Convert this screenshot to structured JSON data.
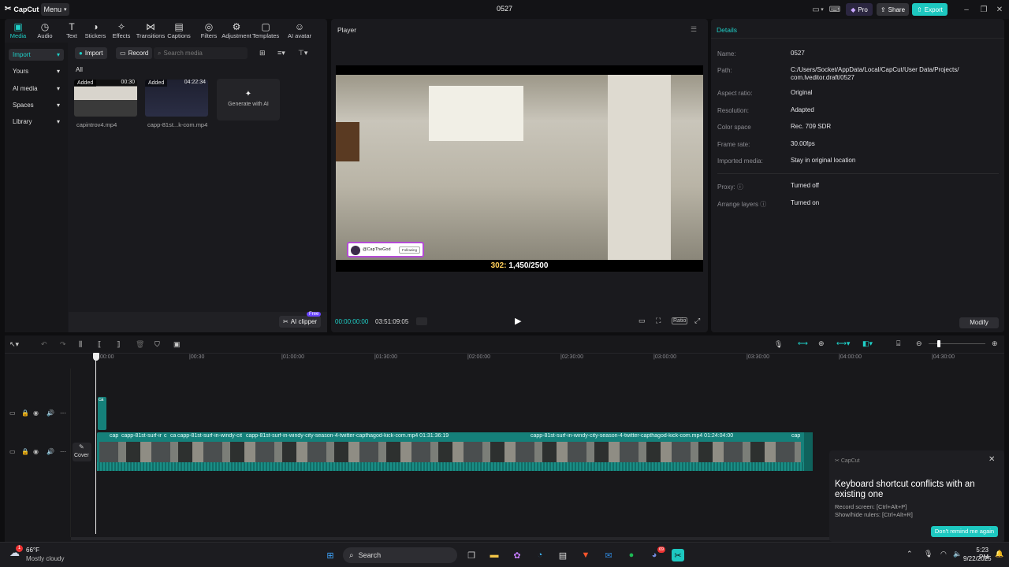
{
  "app": {
    "logo_text": "CapCut",
    "menu_label": "Menu",
    "project_title": "0527"
  },
  "topbar": {
    "pro_label": "Pro",
    "share_label": "Share",
    "export_label": "Export"
  },
  "media_tabs": [
    {
      "label": "Media",
      "icon": "media-icon"
    },
    {
      "label": "Audio",
      "icon": "audio-icon"
    },
    {
      "label": "Text",
      "icon": "text-icon"
    },
    {
      "label": "Stickers",
      "icon": "stickers-icon"
    },
    {
      "label": "Effects",
      "icon": "effects-icon"
    },
    {
      "label": "Transitions",
      "icon": "transitions-icon"
    },
    {
      "label": "Captions",
      "icon": "captions-icon"
    },
    {
      "label": "Filters",
      "icon": "filters-icon"
    },
    {
      "label": "Adjustment",
      "icon": "adjustment-icon"
    },
    {
      "label": "Templates",
      "icon": "templates-icon"
    },
    {
      "label": "AI avatar",
      "icon": "ai-avatar-icon"
    }
  ],
  "sidebar": {
    "items": [
      {
        "label": "Import"
      },
      {
        "label": "Yours"
      },
      {
        "label": "AI media"
      },
      {
        "label": "Spaces"
      },
      {
        "label": "Library"
      }
    ]
  },
  "media": {
    "import_label": "Import",
    "record_label": "Record",
    "search_placeholder": "Search media",
    "filter_label": "All",
    "items": [
      {
        "badge": "Added",
        "duration": "00:30",
        "name": "capintrov4.mp4"
      },
      {
        "badge": "Added",
        "duration": "04:22:34",
        "name": "capp-81st...k-com.mp4"
      }
    ],
    "generate_label": "Generate with AI",
    "ai_clipper_label": "AI clipper",
    "ai_clipper_badge": "Free"
  },
  "player": {
    "title": "Player",
    "current_time": "00:00:00:00",
    "total_time": "03:51:09:05",
    "ratio_label": "Ratio",
    "overlay_counter_a": "302:",
    "overlay_counter_b": "1,450/2500",
    "overlay_handle": "@CapTheGod",
    "overlay_follow": "Following"
  },
  "details": {
    "title": "Details",
    "rows": [
      {
        "label": "Name:",
        "value": "0527"
      },
      {
        "label": "Path:",
        "value": "C:/Users/Socket/AppData/Local/CapCut/User Data/Projects/",
        "value2": "com.lveditor.draft/0527"
      },
      {
        "label": "Aspect ratio:",
        "value": "Original"
      },
      {
        "label": "Resolution:",
        "value": "Adapted"
      },
      {
        "label": "Color space",
        "value": "Rec. 709 SDR"
      },
      {
        "label": "Frame rate:",
        "value": "30.00fps"
      },
      {
        "label": "Imported media:",
        "value": "Stay in original location"
      },
      {
        "label": "Proxy:",
        "value": "Turned off"
      },
      {
        "label": "Arrange layers",
        "value": "Turned on"
      }
    ],
    "modify_label": "Modify"
  },
  "timeline": {
    "ticks": [
      "00:00",
      "|00:30",
      "|01:00:00",
      "|01:30:00",
      "|02:00:00",
      "|02:30:00",
      "|03:00:00",
      "|03:30:00",
      "|04:00:00",
      "|04:30:00"
    ],
    "cover_label": "Cover",
    "small_clip_label": "ca",
    "clips": [
      {
        "label": "cap"
      },
      {
        "label": "capp-81st-surf-ir"
      },
      {
        "label": "c"
      },
      {
        "label": "ca"
      },
      {
        "label": "capp-81st-surf-in-windy-cit"
      },
      {
        "label": "capp-81st-surf-in-windy-city-season-4-twitter-capthagod-kick-com.mp4   01:31:36:19"
      },
      {
        "label": "capp-81st-surf-in-windy-city-season-4-twitter-capthagod-kick-com.mp4   01:24:04:00"
      },
      {
        "label": "cap"
      }
    ]
  },
  "toast": {
    "app": "CapCut",
    "title": "Keyboard shortcut conflicts with an existing one",
    "line1": "Record screen: [Ctrl+Alt+P]",
    "line2": "Show/hide rulers: [Ctrl+Alt+R]",
    "button": "Don't remind me again"
  },
  "taskbar": {
    "weather_temp": "66°F",
    "weather_desc": "Mostly cloudy",
    "search_label": "Search",
    "time": "5:23 PM",
    "date": "9/22/2025",
    "weather_badge": "1",
    "discord_badge": "69"
  }
}
